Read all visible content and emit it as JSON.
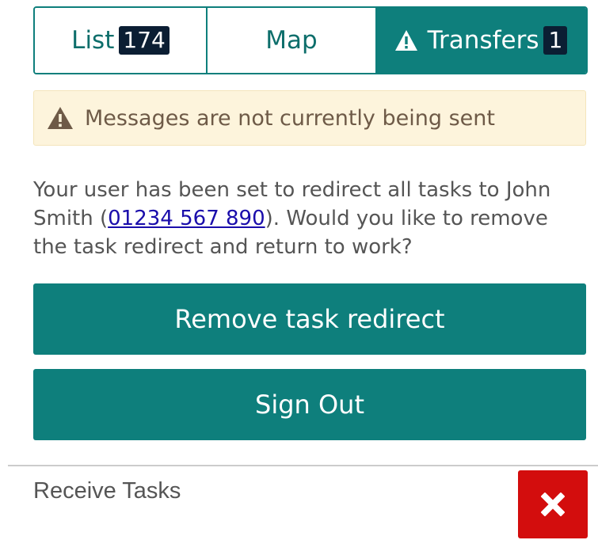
{
  "tabs": {
    "list": {
      "label": "List",
      "count": "174"
    },
    "map": {
      "label": "Map"
    },
    "transfers": {
      "label": "Transfers",
      "count": "1",
      "icon": "warning-icon"
    },
    "active": "transfers"
  },
  "alert": {
    "icon": "warning-icon",
    "text": "Messages are not currently being sent"
  },
  "message": {
    "before": "Your user has been set to redirect all tasks to John Smith (",
    "phone": "01234 567 890",
    "after": "). Would you like to remove the task redirect and return to work?"
  },
  "buttons": {
    "remove_redirect": "Remove task redirect",
    "sign_out": "Sign Out"
  },
  "receive_tasks": {
    "label": "Receive Tasks",
    "state": "off",
    "icon": "close-icon"
  },
  "colors": {
    "primary": "#0e7f7c",
    "badge_dark": "#0b1e33",
    "alert_bg": "#fdf4dc",
    "alert_text": "#6e5a47",
    "danger": "#d30d0d",
    "link": "#1a0dab"
  }
}
